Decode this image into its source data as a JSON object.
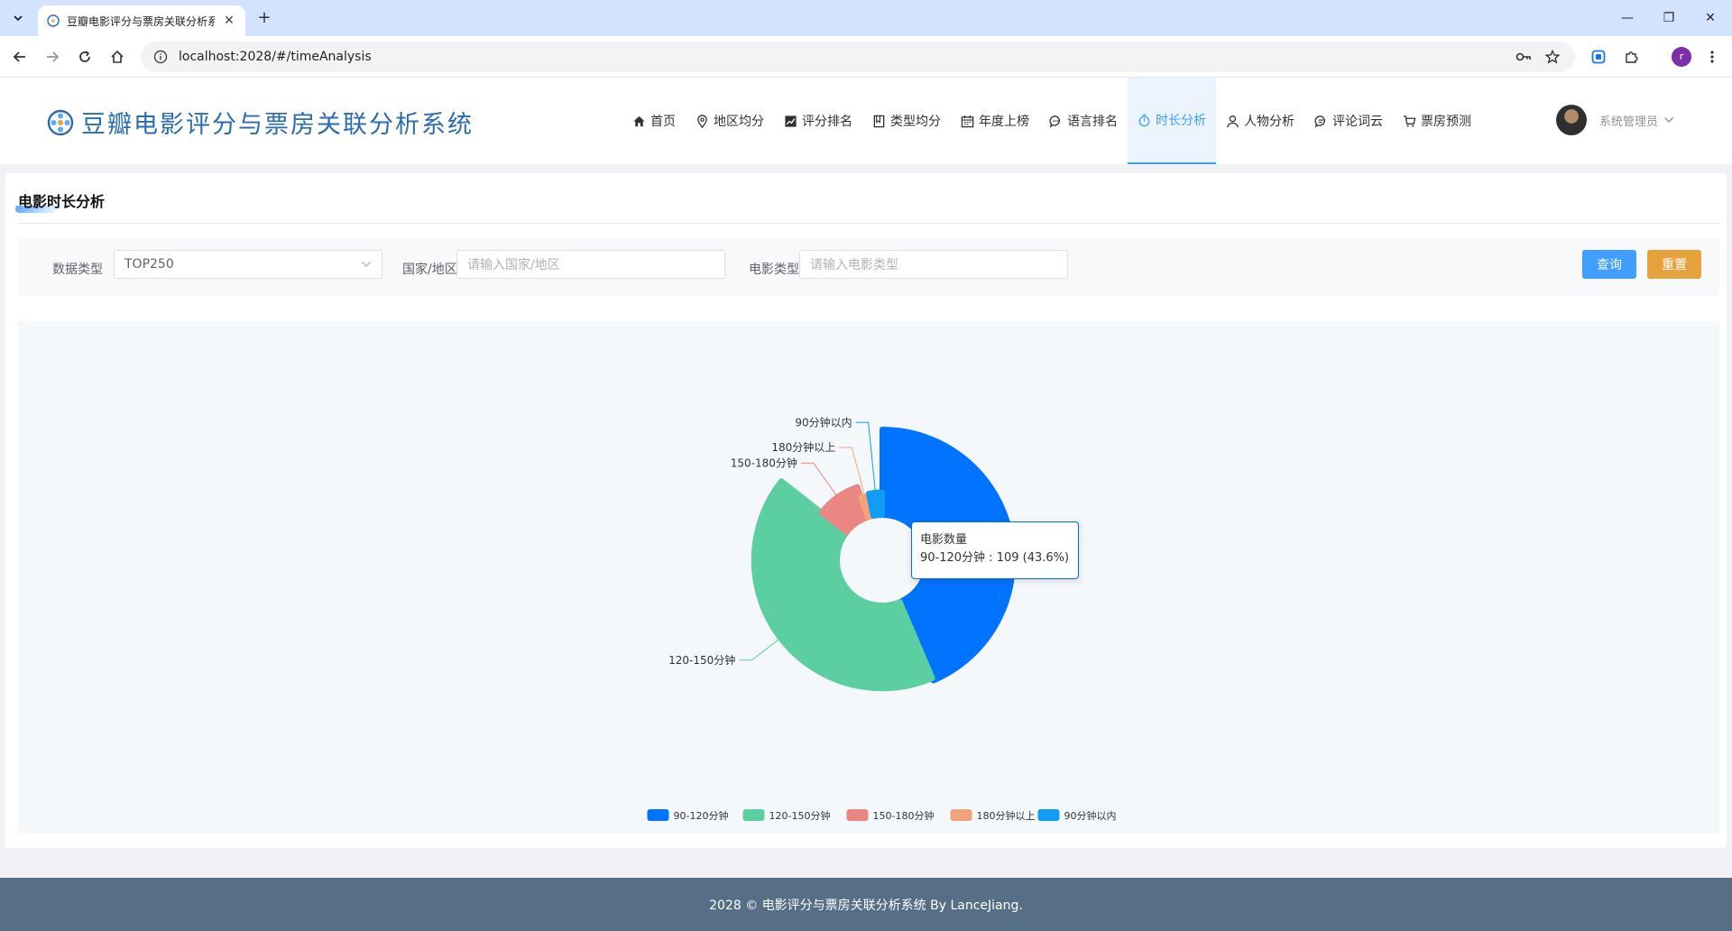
{
  "browser": {
    "tab_title": "豆瓣电影评分与票房关联分析系统",
    "url": "localhost:2028/#/timeAnalysis",
    "profile_initial": "r"
  },
  "header": {
    "brand_title": "豆瓣电影评分与票房关联分析系统",
    "nav": [
      {
        "label": "首页",
        "icon": "home-icon"
      },
      {
        "label": "地区均分",
        "icon": "location-icon"
      },
      {
        "label": "评分排名",
        "icon": "trend-chart-icon"
      },
      {
        "label": "类型均分",
        "icon": "notebook-icon"
      },
      {
        "label": "年度上榜",
        "icon": "calendar-icon"
      },
      {
        "label": "语言排名",
        "icon": "chat-icon"
      },
      {
        "label": "时长分析",
        "icon": "stopwatch-icon"
      },
      {
        "label": "人物分析",
        "icon": "user-icon"
      },
      {
        "label": "评论词云",
        "icon": "comment-icon"
      },
      {
        "label": "票房预测",
        "icon": "cart-icon"
      }
    ],
    "active_nav": "时长分析",
    "user_name": "系统管理员"
  },
  "page": {
    "title": "电影时长分析"
  },
  "filters": {
    "data_type_label": "数据类型",
    "data_type_value": "TOP250",
    "country_label": "国家/地区",
    "country_placeholder": "请输入国家/地区",
    "genre_label": "电影类型",
    "genre_placeholder": "请输入电影类型",
    "query_button": "查询",
    "reset_button": "重置"
  },
  "chart_data": {
    "type": "pie",
    "subtype": "rose-donut",
    "series_name": "电影数量",
    "slices": [
      {
        "label": "90-120分钟",
        "value": 109,
        "color": "#0073ff"
      },
      {
        "label": "120-150分钟",
        "value": 105,
        "color": "#5ccfa2"
      },
      {
        "label": "150-180分钟",
        "value": 23,
        "color": "#ea8783"
      },
      {
        "label": "180分钟以上",
        "value": 5,
        "color": "#f4a27b"
      },
      {
        "label": "90分钟以内",
        "value": 8,
        "color": "#119cf5"
      }
    ],
    "legend_position": "bottom-center",
    "tooltip": {
      "title": "电影数量",
      "text": "90-120分钟 : 109 (43.6%)"
    }
  },
  "footer": {
    "text": "2028 © 电影评分与票房关联分析系统 By LanceJiang."
  },
  "colors": {
    "primary": "#409eff",
    "warning": "#e6a23c",
    "footer_bg": "#566e86",
    "brand": "#2b6cb0"
  }
}
